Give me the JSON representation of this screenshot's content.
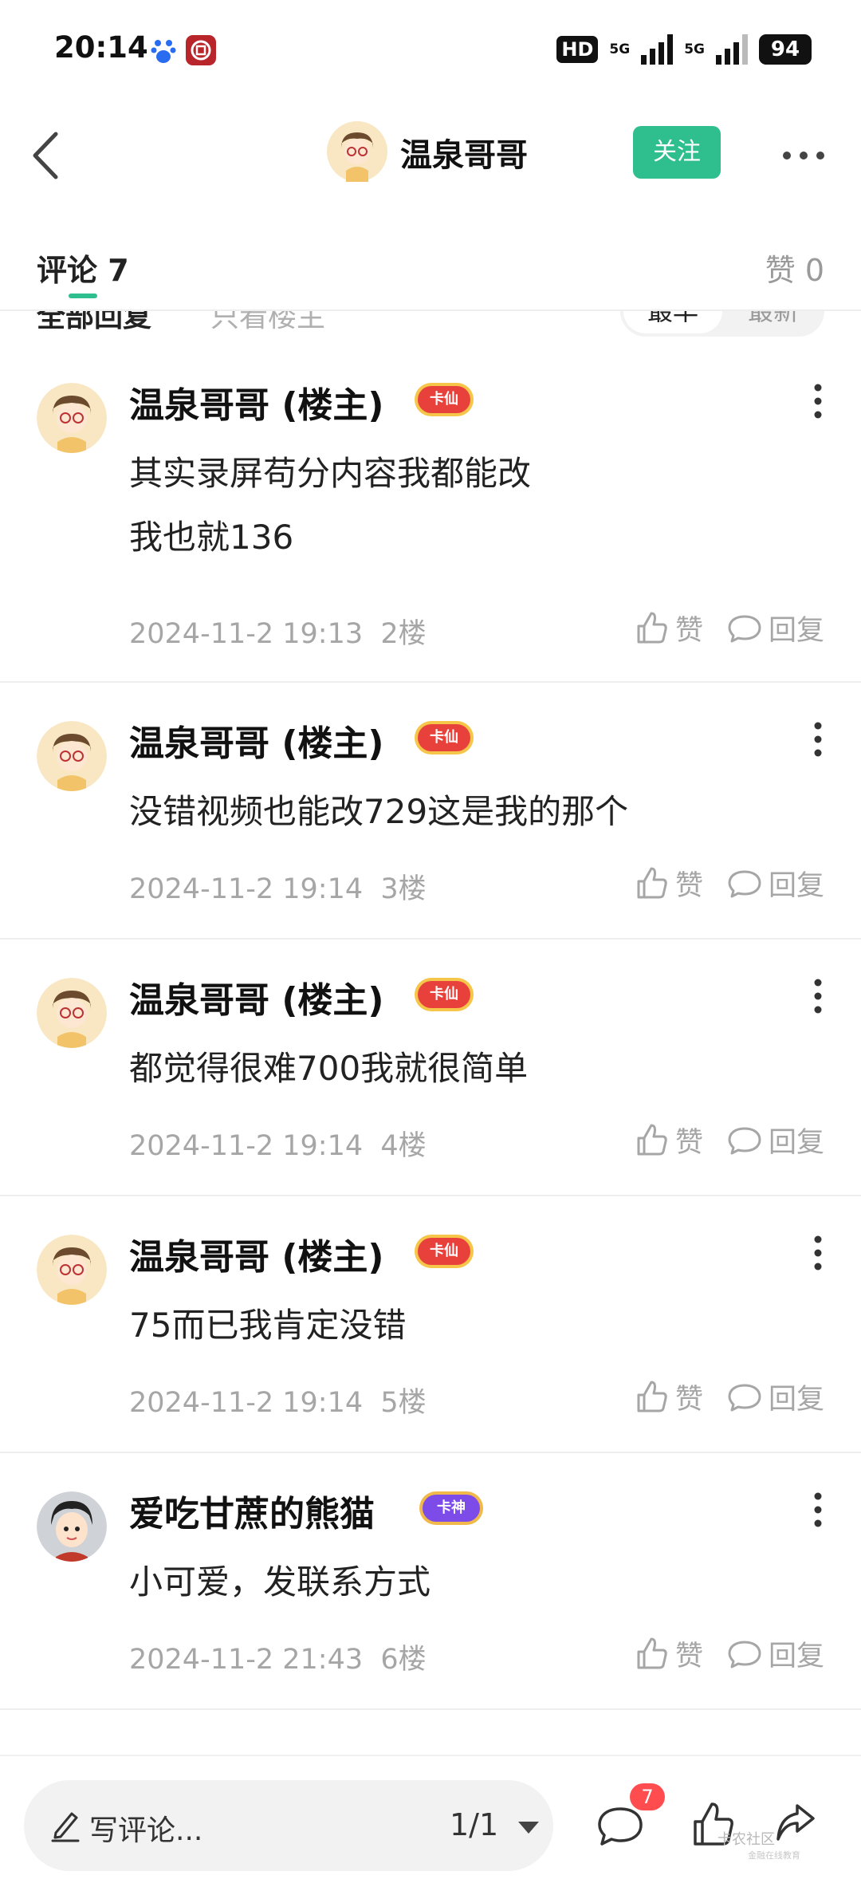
{
  "status_bar": {
    "time": "20:14",
    "hd": "HD",
    "sim1": "5G",
    "sim2": "5G",
    "battery": "94"
  },
  "header": {
    "title": "温泉哥哥",
    "follow_label": "关注"
  },
  "tabs": {
    "comments": "评论 7",
    "likes": "赞 0"
  },
  "filters": {
    "all": "全部回复",
    "host_only": "只看楼主",
    "earliest": "最早",
    "latest": "最新"
  },
  "comments": [
    {
      "user": "温泉哥哥 (楼主)",
      "badge": "卡仙",
      "lines": [
        "其实录屏苟分内容我都能改",
        "我也就136"
      ],
      "time": "2024-11-2 19:13",
      "floor": "2楼",
      "like_label": "赞",
      "reply_label": "回复"
    },
    {
      "user": "温泉哥哥 (楼主)",
      "badge": "卡仙",
      "lines": [
        "没错视频也能改729这是我的那个"
      ],
      "time": "2024-11-2 19:14",
      "floor": "3楼",
      "like_label": "赞",
      "reply_label": "回复"
    },
    {
      "user": "温泉哥哥 (楼主)",
      "badge": "卡仙",
      "lines": [
        "都觉得很难700我就很简单"
      ],
      "time": "2024-11-2 19:14",
      "floor": "4楼",
      "like_label": "赞",
      "reply_label": "回复"
    },
    {
      "user": "温泉哥哥 (楼主)",
      "badge": "卡仙",
      "lines": [
        "75而已我肯定没错"
      ],
      "time": "2024-11-2 19:14",
      "floor": "5楼",
      "like_label": "赞",
      "reply_label": "回复"
    },
    {
      "user": "爱吃甘蔗的熊猫",
      "badge": "卡神",
      "lines": [
        "小可爱，发联系方式"
      ],
      "time": "2024-11-2 21:43",
      "floor": "6楼",
      "like_label": "赞",
      "reply_label": "回复"
    }
  ],
  "bottom_bar": {
    "compose_placeholder": "写评论...",
    "page": "1/1",
    "comment_count": "7",
    "watermark": "卡农社区",
    "watermark_sub": "金融在线教育"
  },
  "colors": {
    "accent": "#2fbf8f",
    "badge_red": "#ff4d4f",
    "text_primary": "#111111",
    "text_secondary": "#a6a6a6"
  }
}
